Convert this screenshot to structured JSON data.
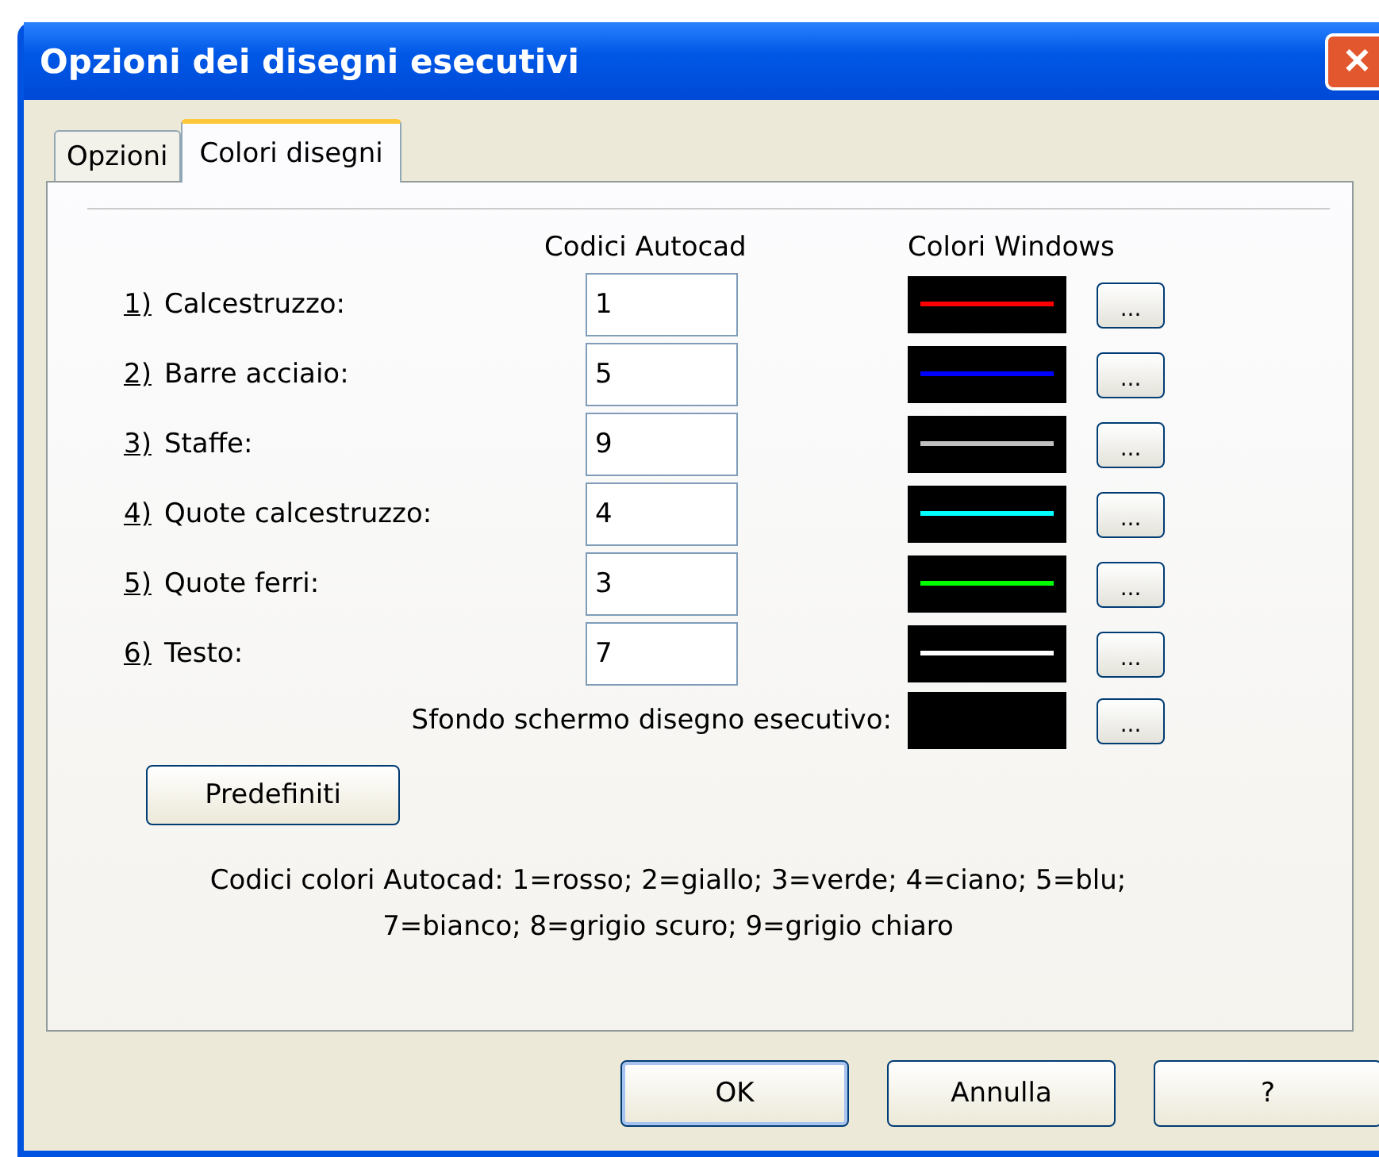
{
  "window": {
    "title": "Opzioni dei disegni esecutivi",
    "close": "✕"
  },
  "tabs": [
    {
      "label": "Opzioni",
      "selected": false
    },
    {
      "label": "Colori disegni",
      "selected": true
    }
  ],
  "headers": {
    "codes": "Codici Autocad",
    "colors": "Colori Windows"
  },
  "rows": [
    {
      "number": "1)",
      "label": "Calcestruzzo:",
      "code": "1",
      "color": "#ff0000",
      "button": "..."
    },
    {
      "number": "2)",
      "label": "Barre acciaio:",
      "code": "5",
      "color": "#0000ff",
      "button": "..."
    },
    {
      "number": "3)",
      "label": "Staffe:",
      "code": "9",
      "color": "#c0c0c0",
      "button": "..."
    },
    {
      "number": "4)",
      "label": "Quote calcestruzzo:",
      "code": "4",
      "color": "#00ffff",
      "button": "..."
    },
    {
      "number": "5)",
      "label": "Quote ferri:",
      "code": "3",
      "color": "#00ff00",
      "button": "..."
    },
    {
      "number": "6)",
      "label": "Testo:",
      "code": "7",
      "color": "#ffffff",
      "button": "..."
    }
  ],
  "background": {
    "label": "Sfondo schermo disegno esecutivo:",
    "color": "#000000",
    "button": "..."
  },
  "defaults_button": "Predefiniti",
  "legend": [
    "Codici colori Autocad: 1=rosso;  2=giallo;  3=verde;  4=ciano;  5=blu;",
    "7=bianco;  8=grigio scuro;  9=grigio chiaro"
  ],
  "buttons": [
    "OK",
    "Annulla",
    "?"
  ]
}
